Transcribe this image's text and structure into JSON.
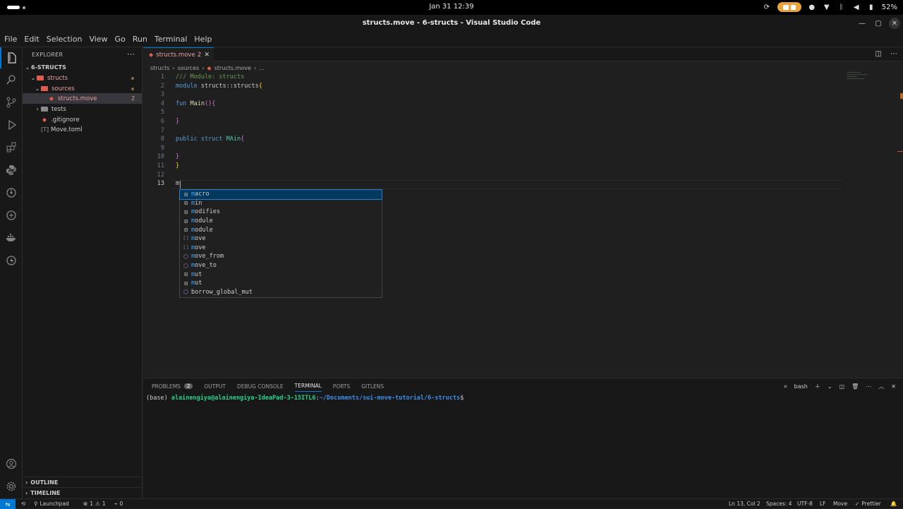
{
  "os": {
    "clock": "Jan 31  12:39",
    "battery": "52%"
  },
  "window": {
    "title": "structs.move - 6-structs - Visual Studio Code"
  },
  "menu": [
    "File",
    "Edit",
    "Selection",
    "View",
    "Go",
    "Run",
    "Terminal",
    "Help"
  ],
  "sidebar": {
    "header": "EXPLORER",
    "project": "6-STRUCTS",
    "items": [
      {
        "label": "structs"
      },
      {
        "label": "sources"
      },
      {
        "label": "structs.move",
        "badge": "2"
      },
      {
        "label": "tests"
      },
      {
        "label": ".gitignore"
      },
      {
        "label": "Move.toml"
      }
    ],
    "outline": "OUTLINE",
    "timeline": "TIMELINE"
  },
  "tab": {
    "label": "structs.move",
    "count": "2"
  },
  "breadcrumb": [
    "structs",
    "sources",
    "structs.move",
    "..."
  ],
  "editor": {
    "line_numbers": [
      "1",
      "2",
      "3",
      "4",
      "5",
      "6",
      "7",
      "8",
      "9",
      "10",
      "11",
      "12",
      "13"
    ],
    "lines": {
      "l1": "/// Module: structs",
      "l2_kw": "module",
      "l2_rest": " structs::structs",
      "l2_brace": "{",
      "l4_kw": "fun",
      "l4_fn": "Main",
      "l4_paren": "()",
      "l4_brace": "{",
      "l6": "}",
      "l8_kw": "public struct",
      "l8_ty": "MAin",
      "l8_brace": "{",
      "l10": "}",
      "l11": "}",
      "l13": "m"
    }
  },
  "suggest": {
    "items": [
      {
        "icon": "keyword",
        "match": "m",
        "rest": "acro"
      },
      {
        "icon": "keyword",
        "match": "m",
        "rest": "in"
      },
      {
        "icon": "keyword",
        "match": "m",
        "rest": "odifies"
      },
      {
        "icon": "keyword",
        "match": "m",
        "rest": "odule"
      },
      {
        "icon": "keyword",
        "match": "m",
        "rest": "odule"
      },
      {
        "icon": "snippet",
        "match": "m",
        "rest": "ove"
      },
      {
        "icon": "snippet",
        "match": "m",
        "rest": "ove"
      },
      {
        "icon": "function",
        "match": "m",
        "rest": "ove_from"
      },
      {
        "icon": "function",
        "match": "m",
        "rest": "ove_to"
      },
      {
        "icon": "keyword",
        "match": "m",
        "rest": "ut"
      },
      {
        "icon": "keyword",
        "match": "m",
        "rest": "ut"
      },
      {
        "icon": "function",
        "match": "",
        "rest": "borrow_global_mut"
      }
    ]
  },
  "panel": {
    "tabs": [
      "PROBLEMS",
      "OUTPUT",
      "DEBUG CONSOLE",
      "TERMINAL",
      "PORTS",
      "GITLENS"
    ],
    "problems_count": "2",
    "shell": "bash",
    "terminal": {
      "env": "(base) ",
      "user": "alainengiya@alainengiya-IdeaPad-3-15ITL6",
      "colon": ":",
      "path": "~/Documents/sui-move-tutorial/6-structs",
      "dollar": "$"
    }
  },
  "status": {
    "launchpad": "Launchpad",
    "errors": "1",
    "warnings": "1",
    "ports": "0",
    "position": "Ln 13, Col 2",
    "spaces": "Spaces: 4",
    "encoding": "UTF-8",
    "eol": "LF",
    "language": "Move",
    "formatter": "Prettier"
  }
}
